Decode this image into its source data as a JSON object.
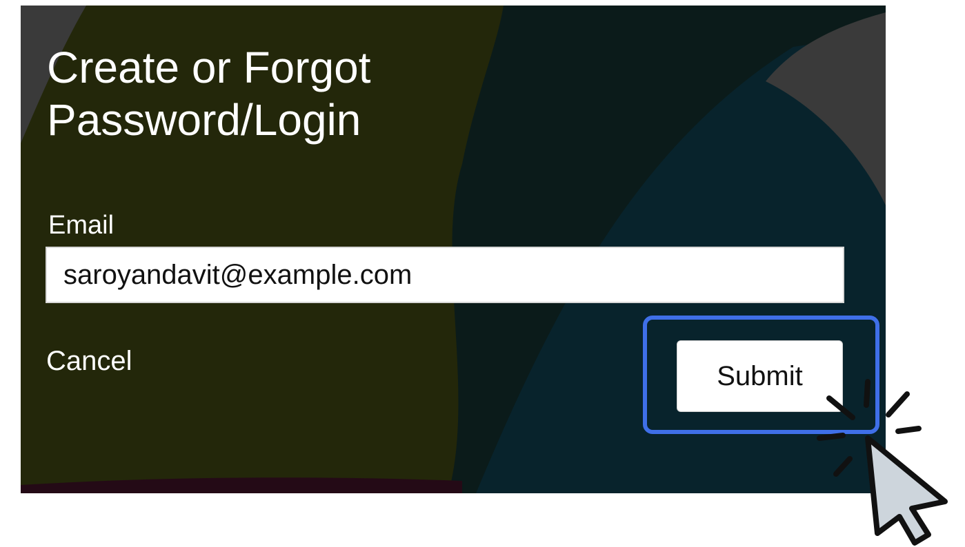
{
  "dialog": {
    "title_line1": "Create or Forgot",
    "title_line2": "Password/Login",
    "email_label": "Email",
    "email_value": "saroyandavit@example.com",
    "cancel_label": "Cancel",
    "submit_label": "Submit"
  },
  "colors": {
    "bg_olive": "#23270a",
    "bg_teal": "#0a232b",
    "highlight": "#3f6fe8",
    "cursor_fill": "#cdd5dc"
  },
  "icons": {
    "pointer": "cursor-arrow-icon",
    "click_burst": "click-burst-icon"
  }
}
